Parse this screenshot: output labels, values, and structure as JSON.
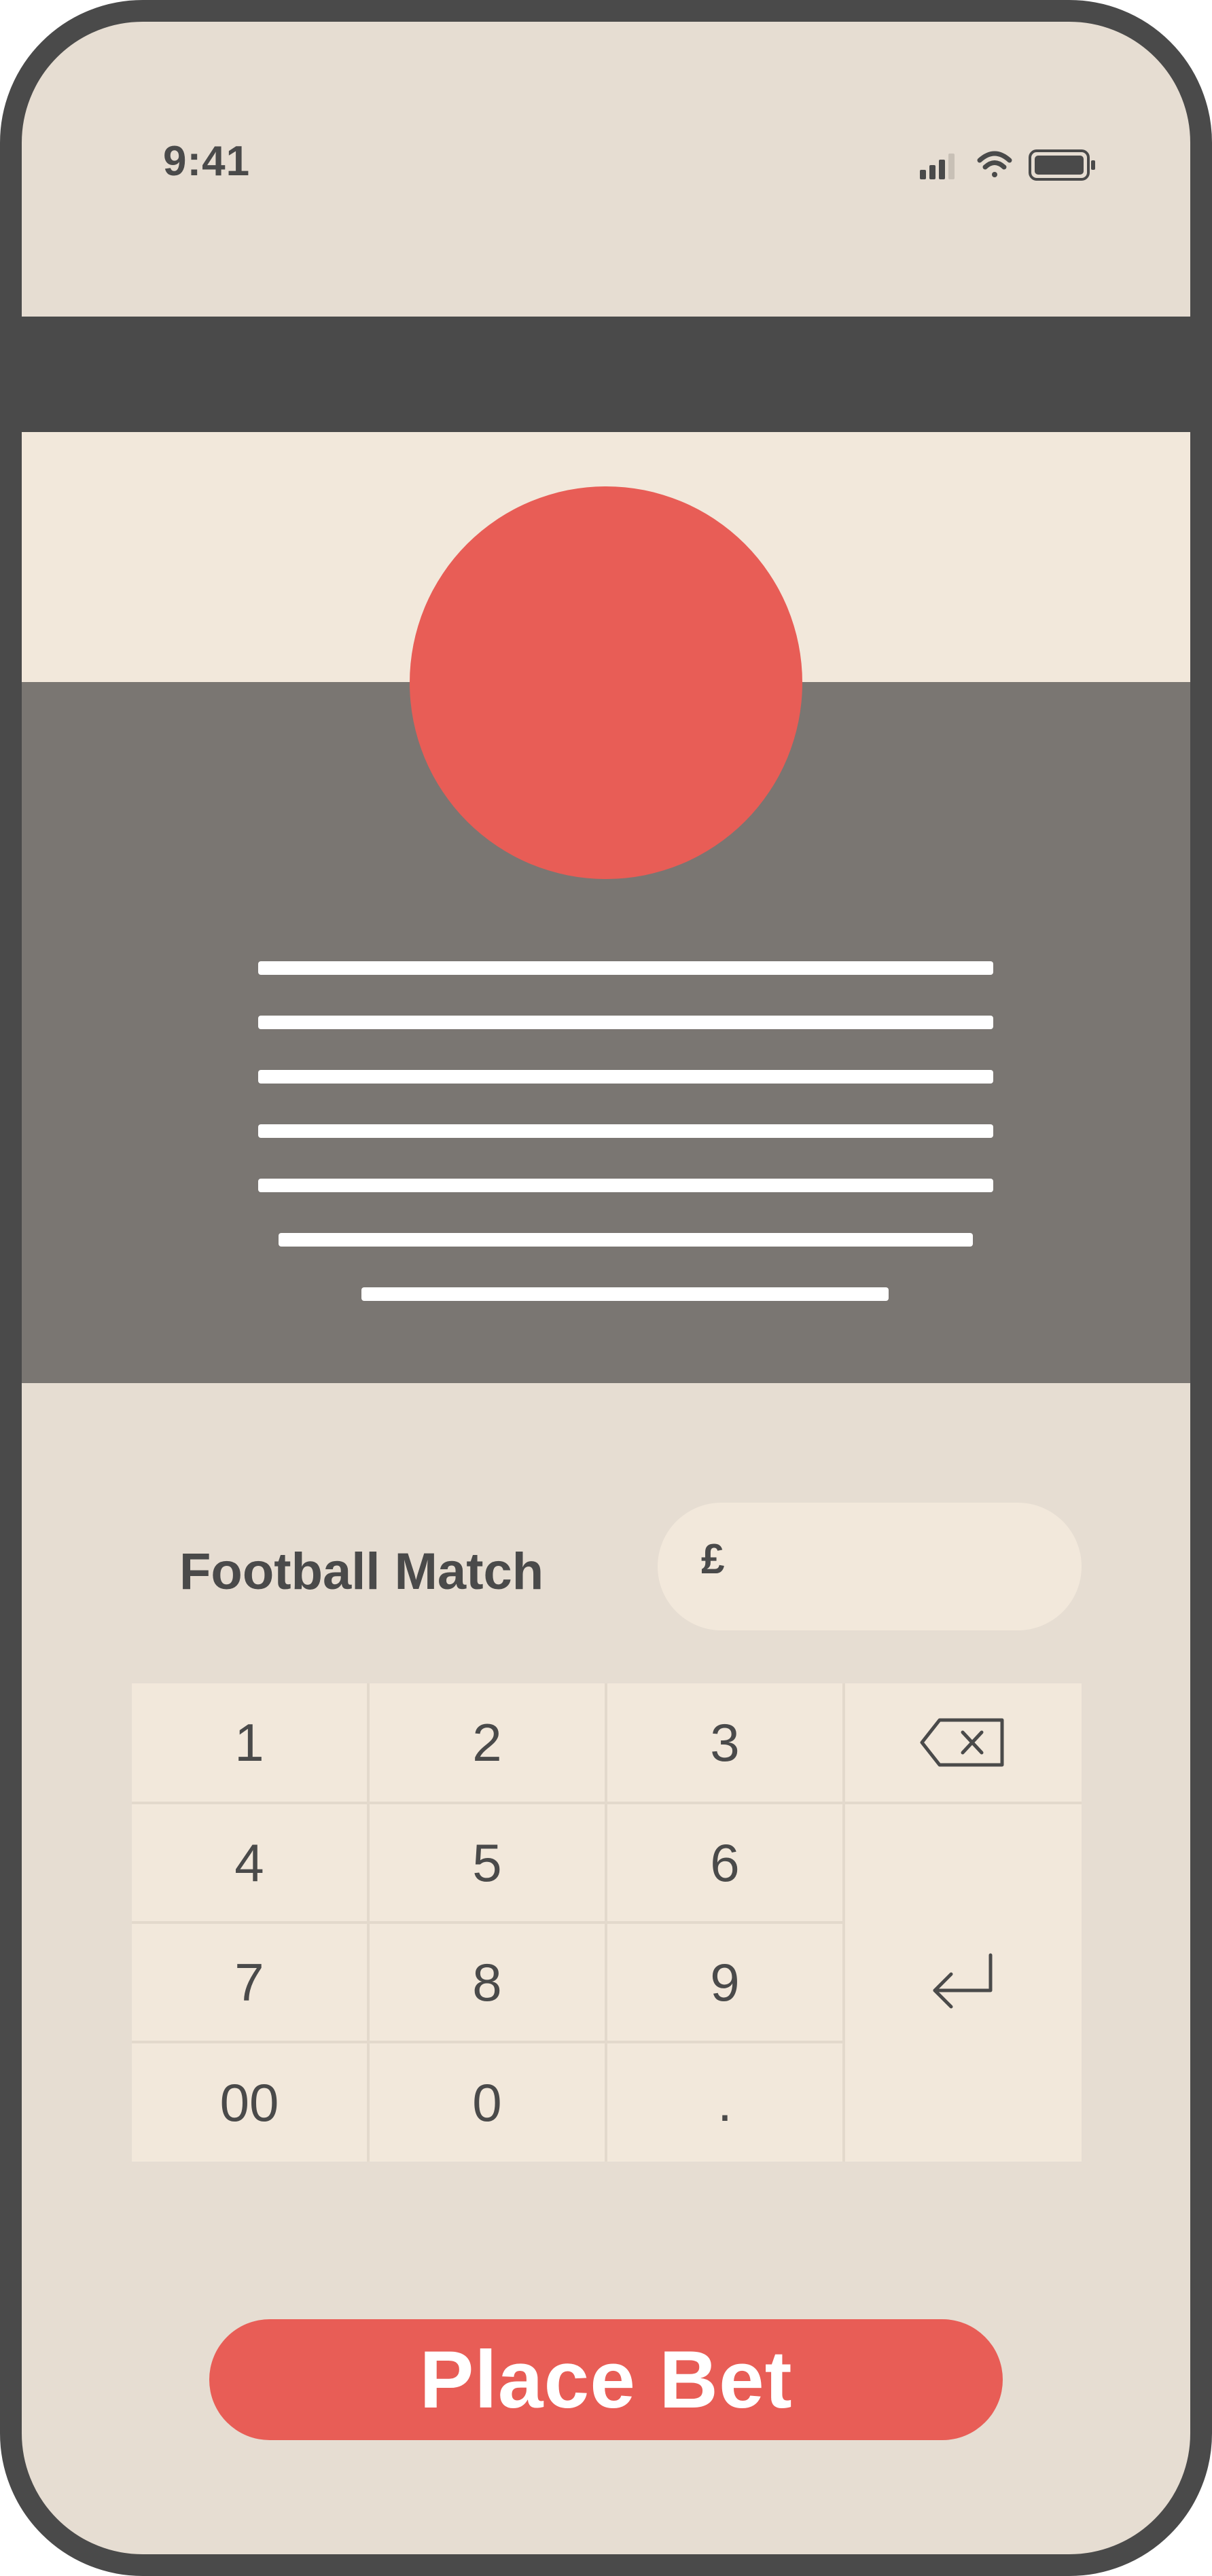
{
  "status_bar": {
    "time": "9:41",
    "icons": [
      "cellular-signal-icon",
      "wifi-icon",
      "battery-icon"
    ]
  },
  "colors": {
    "frame": "#4a4a4a",
    "background": "#e6ddd2",
    "panel": "#f2e8db",
    "hero_dark": "#7a7672",
    "accent": "#e85d56",
    "text": "#4a4a4a"
  },
  "bet": {
    "match_label": "Football Match",
    "currency_symbol": "£",
    "amount": ""
  },
  "keypad": {
    "keys": [
      "1",
      "2",
      "3",
      "4",
      "5",
      "6",
      "7",
      "8",
      "9",
      "00",
      "0",
      "."
    ],
    "backspace_icon": "backspace-icon",
    "enter_icon": "enter-icon"
  },
  "actions": {
    "place_bet_label": "Place Bet"
  }
}
